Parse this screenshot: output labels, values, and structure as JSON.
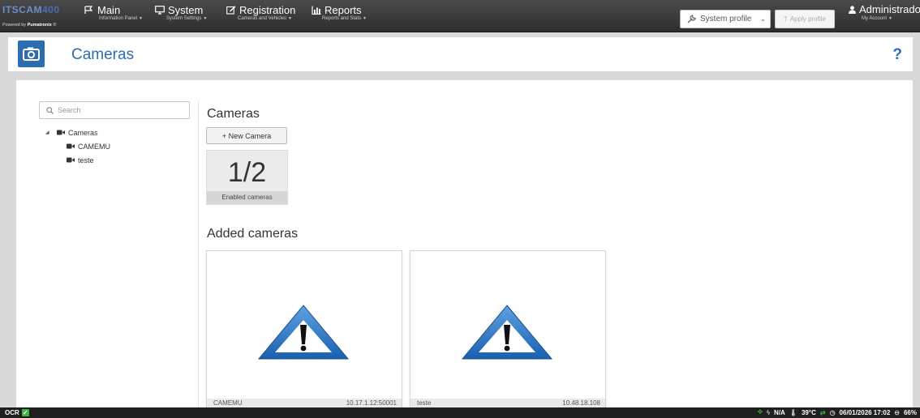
{
  "brand": {
    "logo": "ITSCAM",
    "logo_suffix": "400",
    "powered_prefix": "Powered by",
    "powered_name": "Pumatronix"
  },
  "nav": {
    "main": {
      "label": "Main",
      "sub": "Information Panel"
    },
    "system": {
      "label": "System",
      "sub": "System Settings"
    },
    "registration": {
      "label": "Registration",
      "sub": "Cameras and Vehicles"
    },
    "reports": {
      "label": "Reports",
      "sub": "Reports and Stats"
    }
  },
  "profile": {
    "selected": "System profile",
    "apply_label": "Apply profile"
  },
  "user": {
    "name": "Administrador",
    "sub": "My Account"
  },
  "page": {
    "title": "Cameras",
    "help": "?"
  },
  "sidebar": {
    "search_placeholder": "Search",
    "tree_root": "Cameras",
    "tree_children": [
      "CAMEMU",
      "teste"
    ]
  },
  "content": {
    "heading": "Cameras",
    "new_camera": "+ New Camera",
    "enabled_value": "1/2",
    "enabled_label": "Enabled cameras",
    "added_heading": "Added cameras",
    "cards": [
      {
        "name": "CAMEMU",
        "address": "10.17.1.12:50001"
      },
      {
        "name": "teste",
        "address": "10.48.18.108"
      }
    ]
  },
  "status": {
    "ocr": "OCR",
    "power": "N/A",
    "temperature": "39°C",
    "datetime": "06/01/2026 17:02",
    "disk": "66%"
  },
  "colors": {
    "accent": "#2b6db0",
    "ok": "#3fb24a",
    "navbar": "#3a3a3a"
  }
}
